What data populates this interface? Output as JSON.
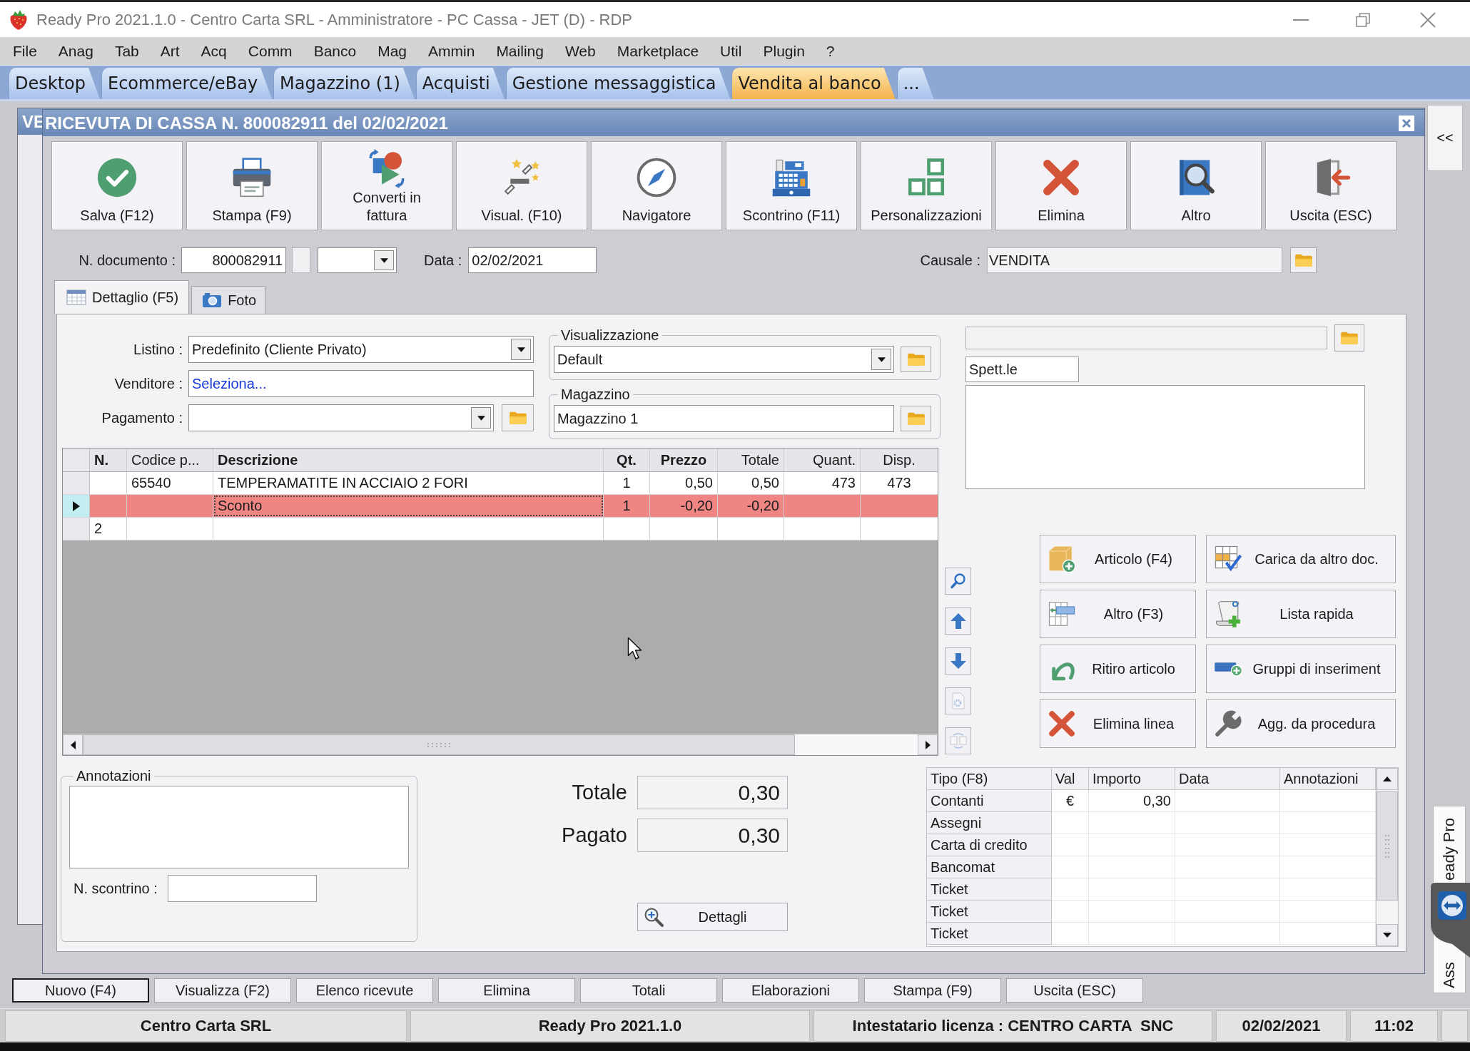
{
  "window": {
    "title": "Ready Pro 2021.1.0 - Centro Carta SRL - Amministratore - PC Cassa - JET (D) - RDP"
  },
  "menu": [
    "File",
    "Anag",
    "Tab",
    "Art",
    "Acq",
    "Comm",
    "Banco",
    "Mag",
    "Ammin",
    "Mailing",
    "Web",
    "Marketplace",
    "Util",
    "Plugin",
    "?"
  ],
  "tabs": [
    {
      "label": "Desktop",
      "selected": false
    },
    {
      "label": "Ecommerce/eBay",
      "selected": false
    },
    {
      "label": "Magazzino (1)",
      "selected": false
    },
    {
      "label": "Acquisti",
      "selected": false
    },
    {
      "label": "Gestione messaggistica",
      "selected": false
    },
    {
      "label": "Vendita al banco",
      "selected": true
    },
    {
      "label": "...",
      "selected": false
    }
  ],
  "background_window": {
    "title": "VE",
    "buttons": [
      {
        "label": "Nuovo (F4)",
        "default": true
      },
      {
        "label": "Visualizza (F2)",
        "default": false
      },
      {
        "label": "Elenco ricevute",
        "default": false
      },
      {
        "label": "Elimina",
        "default": false
      },
      {
        "label": "Totali",
        "default": false
      },
      {
        "label": "Elaborazioni",
        "default": false
      },
      {
        "label": "Stampa (F9)",
        "default": false
      },
      {
        "label": "Uscita (ESC)",
        "default": false
      }
    ]
  },
  "dialog": {
    "title": "RICEVUTA DI CASSA N. 800082911 del 02/02/2021",
    "toolbar": [
      {
        "label": "Salva (F12)",
        "kind": "save"
      },
      {
        "label": "Stampa (F9)",
        "kind": "print"
      },
      {
        "label": "Converti in\nfattura",
        "kind": "convert"
      },
      {
        "label": "Visual. (F10)",
        "kind": "view"
      },
      {
        "label": "Navigatore",
        "kind": "navigator"
      },
      {
        "label": "Scontrino (F11)",
        "kind": "receipt"
      },
      {
        "label": "Personalizzazioni",
        "kind": "customize"
      },
      {
        "label": "Elimina",
        "kind": "delete"
      },
      {
        "label": "Altro",
        "kind": "more"
      },
      {
        "label": "Uscita (ESC)",
        "kind": "exit"
      }
    ],
    "document": {
      "number_label": "N. documento :",
      "number": "800082911",
      "date_label": "Data :",
      "date": "02/02/2021",
      "reason_label": "Causale :",
      "reason": "VENDITA"
    },
    "tabs": [
      {
        "label": "Dettaglio (F5)",
        "selected": true,
        "kind": "table"
      },
      {
        "label": "Foto",
        "selected": false,
        "kind": "photo"
      }
    ],
    "fields": [
      {
        "label": "Listino :",
        "value": "Predefinito (Cliente Privato)",
        "kind": "dropdown"
      },
      {
        "label": "Venditore :",
        "value": "Seleziona...",
        "kind": "link"
      },
      {
        "label": "Pagamento :",
        "kind": "lookup"
      }
    ],
    "groups": [
      {
        "legend": "Visualizzazione",
        "value": "Default",
        "kind": "dropdown"
      },
      {
        "legend": "Magazzino",
        "value": "Magazzino 1",
        "kind": "text"
      }
    ],
    "lines": {
      "columns": [
        {
          "label": "N.",
          "bold": true
        },
        {
          "label": "Codice p...",
          "bold": false
        },
        {
          "label": "Descrizione",
          "bold": true
        },
        {
          "label": "Qt.",
          "bold": true
        },
        {
          "label": "Prezzo",
          "bold": true
        },
        {
          "label": "Totale",
          "bold": false
        },
        {
          "label": "Quant.",
          "bold": false
        },
        {
          "label": "Disp.",
          "bold": false
        }
      ],
      "rows": [
        {
          "selected": false,
          "cells": [
            null,
            "65540",
            "TEMPERAMATITE IN ACCIAIO 2 FORI",
            "1",
            "0,50",
            "0,50",
            "473",
            "473"
          ]
        },
        {
          "selected": true,
          "cells": [
            null,
            null,
            {
              "text": "Sconto",
              "focused": true
            },
            "1",
            "-0,20",
            "-0,20"
          ]
        },
        {
          "selected": false,
          "cells": [
            "2"
          ]
        }
      ]
    },
    "side_tools": [
      {
        "kind": "search",
        "disabled": false
      },
      {
        "kind": "up",
        "disabled": false
      },
      {
        "kind": "down",
        "disabled": false
      },
      {
        "kind": "settings",
        "disabled": true
      },
      {
        "kind": "swap",
        "disabled": true
      }
    ],
    "customer": {
      "salutation": "Spett.le"
    },
    "actions": [
      {
        "label": "Articolo (F4)",
        "kind": "article"
      },
      {
        "label": "Carica da altro doc.",
        "kind": "load"
      },
      {
        "label": "Altro (F3)",
        "kind": "other"
      },
      {
        "label": "Lista rapida",
        "kind": "quicklist"
      },
      {
        "label": "Ritiro articolo",
        "kind": "return"
      },
      {
        "label": "Gruppi di inseriment",
        "kind": "groups"
      },
      {
        "label": "Elimina linea",
        "kind": "deleteline"
      },
      {
        "label": "Agg. da procedura",
        "kind": "update"
      }
    ],
    "notes": {
      "legend": "Annotazioni",
      "receipt_label": "N. scontrino :"
    },
    "totals": [
      {
        "label": "Totale",
        "value": "0,30"
      },
      {
        "label": "Pagato",
        "value": "0,30"
      }
    ],
    "details_button": "Dettagli",
    "payments": {
      "columns": [
        "Tipo (F8)",
        "Val",
        "Importo",
        "Data",
        "Annotazioni"
      ],
      "rows": [
        [
          "Contanti",
          "€",
          "0,30"
        ],
        [
          "Assegni"
        ],
        [
          "Carta di credito"
        ],
        [
          "Bancomat"
        ],
        [
          "Ticket"
        ],
        [
          "Ticket"
        ],
        [
          "Ticket"
        ]
      ]
    }
  },
  "side_panel": {
    "collapse_label": "<<",
    "tab_texts": [
      "Ass",
      "eady Pro"
    ]
  },
  "status_bar": [
    "Centro Carta SRL",
    "Ready Pro 2021.1.0",
    "Intestatario licenza : CENTRO CARTA  SNC",
    "02/02/2021",
    "11:02"
  ]
}
